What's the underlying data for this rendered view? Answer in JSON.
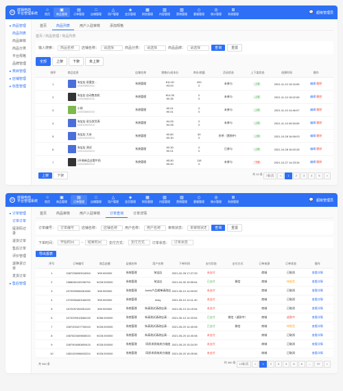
{
  "header": {
    "logo": "底销电商",
    "logo_sub": "平台管理系统",
    "nav": [
      "首页",
      "商品管理",
      "订单管理",
      "店铺管理",
      "用户管理",
      "会员管理",
      "财务管理",
      "内容管理",
      "营销管理",
      "客服管理",
      "统计管理",
      "系统管理"
    ],
    "admin": "超级管理员"
  },
  "panel1": {
    "sidebar_groups": [
      {
        "name": "商品管理",
        "items": [
          "商品列表",
          "商品审核",
          "商品分类",
          "平台规格",
          "品牌管理"
        ]
      },
      {
        "name": "类目管理",
        "items": []
      },
      {
        "name": "店铺管理",
        "items": []
      },
      {
        "name": "标签管理",
        "items": []
      }
    ],
    "tabs": [
      "首页",
      "商品列表",
      "用户入驻审核",
      "添加规格"
    ],
    "breadcrumb": "首页 / 商品管理 / 商品列表",
    "filters": {
      "name_label": "输入搜索：",
      "name_placeholder": "商品名称",
      "status_label": "店铺名称：",
      "status_placeholder": "请选择",
      "cat_label": "商品分类：",
      "cat_placeholder": "请选择",
      "brand_label": "商品品牌：",
      "brand_placeholder": "请选择",
      "search": "查询",
      "reset": "重置"
    },
    "status_tabs": [
      "全部",
      "上架",
      "下架",
      "未上架"
    ],
    "columns": [
      "排序",
      "商品信息",
      "店铺名称",
      "销售价/成本价",
      "库存/销量",
      "活动状态",
      "上下架状态",
      "创建时间",
      "操作"
    ],
    "rows": [
      {
        "img": "blue",
        "name": "淘宝店 说要女...",
        "sku": "1000008892031",
        "store": "系统管理",
        "price": "¥11.00",
        "cost": "¥3.00",
        "stock": "200",
        "sold": "0",
        "activity": "未参与",
        "status": "上架",
        "time": "2021-11-10 15:15:55"
      },
      {
        "img": "dark",
        "name": "淘宝店 自动售卖机",
        "sku": "1000008892032",
        "store": "系统管理",
        "price": "¥14.35",
        "cost": "¥0.35",
        "stock": "0",
        "sold": "0",
        "activity": "未参与",
        "status": "上架",
        "time": "2021-11-10 15:02:05"
      },
      {
        "img": "green",
        "name": "小明",
        "sku": "1000008892033",
        "store": "系统管理",
        "price": "¥0.01",
        "cost": "¥0.01",
        "stock": "0",
        "sold": "0",
        "activity": "未参与",
        "status": "上架",
        "time": "2021-11-10 14:46:07"
      },
      {
        "img": "blue",
        "name": "淘宝店 说当发货表",
        "sku": "1000100020015",
        "store": "系统管理",
        "price": "¥4.05",
        "cost": "¥4.08",
        "stock": "0",
        "sold": "0",
        "activity": "未参与",
        "status": "上架",
        "time": "2021-11-10 09:53:59"
      },
      {
        "img": "blue",
        "name": "淘宝店 大米",
        "sku": "1000100020013",
        "store": "系统管理",
        "price": "¥0.80",
        "cost": "¥0.30",
        "stock": "30",
        "sold": "0",
        "activity": "秒杀（营销中）",
        "status": "上架",
        "time": "2021-10-28 16:06:03"
      },
      {
        "img": "blue",
        "name": "淘宝店 测试",
        "sku": "1000100020012",
        "store": "系统管理",
        "price": "¥0.30",
        "cost": "¥0.01",
        "stock": "0",
        "sold": "0",
        "activity": "已参与",
        "status": "上架",
        "time": "2021-10-28 16:02:26"
      },
      {
        "img": "dark",
        "name": "2升装新品全脂牛奶",
        "sku": "1000008892019",
        "store": "系统管理",
        "price": "¥5.50",
        "cost": "¥5.40",
        "stock": "118",
        "sold": "0",
        "activity": "未参与",
        "status": "下架",
        "time": "2021-10-27 14:23:34"
      }
    ],
    "actions": {
      "edit": "编辑",
      "off": "下架",
      "del": "删除",
      "on": "上架"
    },
    "page_info": "共 32 条",
    "page_size": "7条/页",
    "pages": [
      "1",
      "2",
      "3",
      "4",
      "5"
    ]
  },
  "panel2": {
    "sidebar_groups": [
      {
        "name": "订单管理",
        "items": [
          "订单订单",
          "提货码记录",
          "退货订单",
          "售后订单",
          "评价管理",
          "退换货订单",
          "发货订单"
        ]
      },
      {
        "name": "售后管理",
        "items": []
      }
    ],
    "tabs": [
      "首页",
      "商品审核",
      "用户入驻审核",
      "订单查询",
      "订单详情"
    ],
    "filters": {
      "order_label": "订单编号：",
      "order_placeholder": "订单编号",
      "store_label": "店铺名称：",
      "store_placeholder": "店铺名称",
      "user_label": "用户名称：",
      "user_placeholder": "用户名称",
      "status_label": "审核状态：",
      "status_placeholder": "未审核状态",
      "time_label": "下单时间：",
      "time_start": "开始时间",
      "time_end": "结束时间",
      "pay_label": "支付方式：",
      "pay_placeholder": "支付方式",
      "ostatus_label": "订单状态：",
      "ostatus_placeholder": "订单状态",
      "search": "查询",
      "reset": "重置"
    },
    "export": "导出报表",
    "columns": [
      "序号",
      "订单编号",
      "商品金额",
      "店铺名称",
      "用户名称",
      "下单时间",
      "支付状态",
      "支付方式",
      "订单来源",
      "订单状态",
      "操作"
    ],
    "rows": [
      {
        "no": "1",
        "order": "1587236050018304",
        "amount": "¥99.900000",
        "store": "系统管理",
        "user": "淘宝店",
        "time": "2021-02-28 17:27:33",
        "paystat": "未支付",
        "paymethod": "",
        "source": "商城",
        "status": "已取消"
      },
      {
        "no": "2",
        "order": "1588061100336794",
        "amount": "¥228.000000",
        "store": "系统管理",
        "user": "淘宝店",
        "time": "2021-04-30 15:55:54",
        "paystat": "已支付",
        "paymethod": "微信",
        "source": "商城",
        "status": "待发货"
      },
      {
        "no": "3",
        "order": "1570095966361560",
        "amount": "¥99.900000",
        "store": "系统管理",
        "user": "Asink产品威锋请改店",
        "time": "2021-05-10 14:09:59",
        "paystat": "未支付",
        "paymethod": "",
        "source": "商城",
        "status": "已取消"
      },
      {
        "no": "4",
        "order": "1370096460166200",
        "amount": "¥99.900000",
        "store": "系统管理",
        "user": "testy",
        "time": "2021-05-10 14:11:40",
        "paystat": "未支付",
        "paymethod": "",
        "source": "商城",
        "status": "已取消"
      },
      {
        "no": "5",
        "order": "1570097459251100",
        "amount": "¥99.900000",
        "store": "系统管理",
        "user": "朱清测试清改店清测改店清测店测改店清",
        "time": "2021-05-10 14:15:54",
        "paystat": "未支付",
        "paymethod": "",
        "source": "商城",
        "status": "已取消"
      },
      {
        "no": "6",
        "order": "1570299010666100",
        "amount": "¥288.000000",
        "store": "系统管理",
        "user": "朱清测试清改店清测改店清测店测改店清",
        "time": "2021-05-10 14:23:54",
        "paystat": "已支付",
        "paymethod": "微信（退款中）",
        "source": "商城",
        "status": "退款中"
      },
      {
        "no": "7",
        "order": "1587200427700024",
        "amount": "¥228.000000",
        "store": "系统管理",
        "user": "朱清测试清改店清测改店清测店测改店清",
        "time": "2021-05-20 14:40:08",
        "paystat": "已支付",
        "paymethod": "微信",
        "source": "商城",
        "status": "待发货"
      },
      {
        "no": "8",
        "order": "1587823469808024",
        "amount": "¥228.000000",
        "store": "系统管理",
        "user": "朱清测试清改店清测改店清测店测改店清",
        "time": "2021-05-20 14:40:08",
        "paystat": "未支付",
        "paymethod": "",
        "source": "商城",
        "status": "已取消"
      },
      {
        "no": "9",
        "order": "1587904080809424",
        "amount": "¥228.000000",
        "store": "系统管理",
        "user": "同质求质纳其方维度",
        "time": "2021-05-20 15:24:39",
        "paystat": "未支付",
        "paymethod": "",
        "source": "商城",
        "status": "已取消"
      },
      {
        "no": "10",
        "order": "1581100096600224",
        "amount": "¥228.000000",
        "store": "系统管理",
        "user": "同质求质纳其方维度",
        "time": "2021-05-20 15:25:56",
        "paystat": "未支付",
        "paymethod": "",
        "source": "商城",
        "status": "已取消"
      }
    ],
    "action": "查看详情",
    "page_info": "共 980 条",
    "page_size": "10条/页",
    "pages": [
      "1",
      "2",
      "3",
      "4",
      "5",
      "6",
      "...",
      "97"
    ]
  }
}
